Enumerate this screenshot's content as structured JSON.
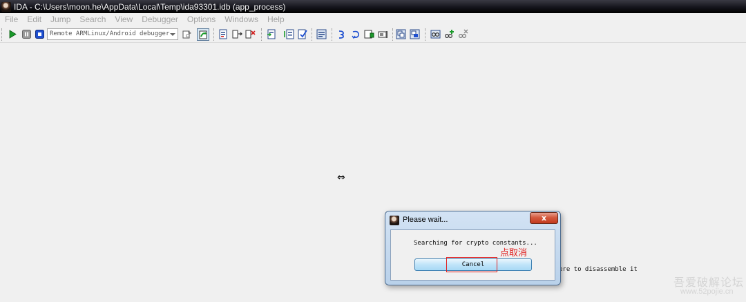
{
  "window": {
    "title": "IDA - C:\\Users\\moon.he\\AppData\\Local\\Temp\\ida93301.idb (app_process)"
  },
  "menu": {
    "items": [
      "File",
      "Edit",
      "Jump",
      "Search",
      "View",
      "Debugger",
      "Options",
      "Windows",
      "Help"
    ]
  },
  "toolbar": {
    "debugger_select": "Remote ARMLinux/Android debugger"
  },
  "background": {
    "partial_text": "ere to disassemble it"
  },
  "watermark": {
    "text": "吾爱破解论坛",
    "url": "www.52pojie.cn"
  },
  "dialog": {
    "title": "Please wait...",
    "close_label": "x",
    "message": "Searching for crypto constants...",
    "cancel_label": "Cancel"
  },
  "annotation": {
    "text": "点取消",
    "color": "#e02020"
  }
}
